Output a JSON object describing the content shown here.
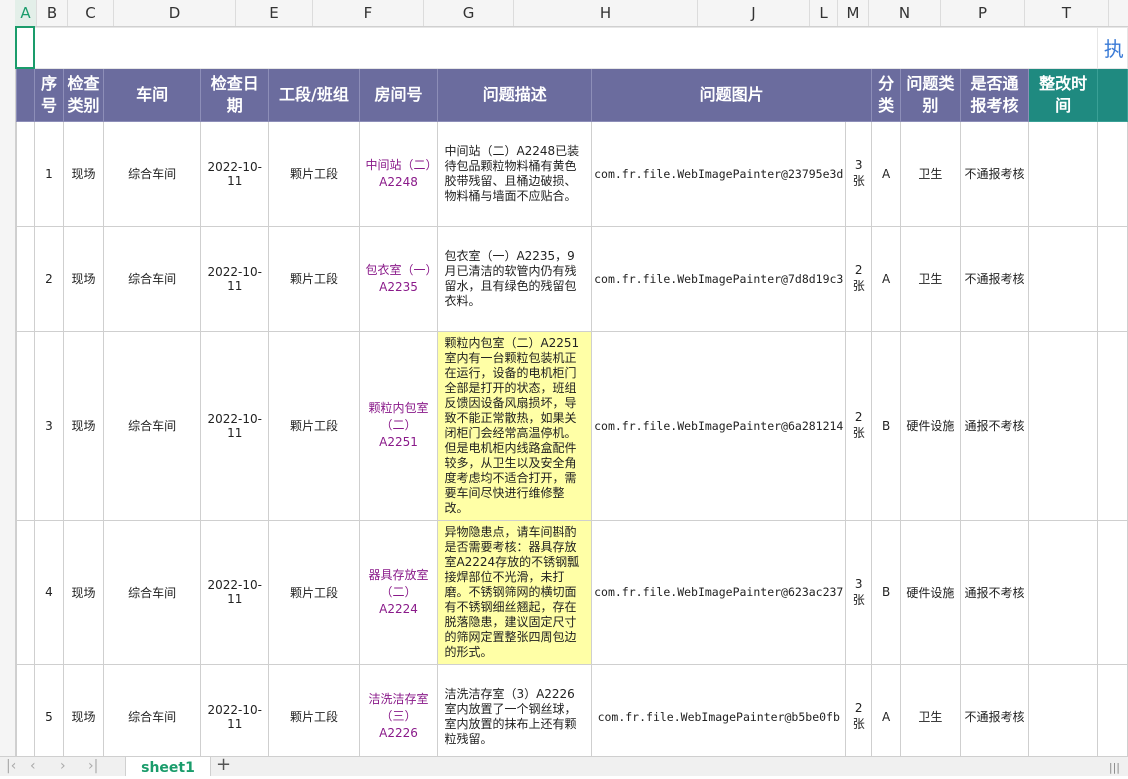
{
  "columns": [
    "A",
    "B",
    "C",
    "D",
    "E",
    "F",
    "G",
    "H",
    "J",
    "L",
    "M",
    "N",
    "P",
    "T"
  ],
  "title_partial": "执",
  "headers": {
    "seq": "序号",
    "check_type": "检查类别",
    "workshop": "车间",
    "check_date": "检查日期",
    "section": "工段/班组",
    "room": "房间号",
    "desc": "问题描述",
    "pic": "问题图片",
    "cls": "分类",
    "prob_type": "问题类别",
    "report": "是否通报考核",
    "fix_time": "整改时间"
  },
  "rows": [
    {
      "seq": "1",
      "type": "现场",
      "workshop": "综合车间",
      "date": "2022-10-11",
      "section": "颗片工段",
      "room": "中间站（二）A2248",
      "desc": "中间站（二）A2248已装待包品颗粒物料桶有黄色胶带残留、且桶边破损、物料桶与墙面不应贴合。",
      "pic": "com.fr.file.WebImagePainter@23795e3d",
      "count": "3张",
      "cls": "A",
      "prob": "卫生",
      "report": "不通报考核",
      "highlight": false
    },
    {
      "seq": "2",
      "type": "现场",
      "workshop": "综合车间",
      "date": "2022-10-11",
      "section": "颗片工段",
      "room": "包衣室（一）A2235",
      "desc": "包衣室（一）A2235，9月已清洁的软管内仍有残留水，且有绿色的残留包衣料。",
      "pic": "com.fr.file.WebImagePainter@7d8d19c3",
      "count": "2张",
      "cls": "A",
      "prob": "卫生",
      "report": "不通报考核",
      "highlight": false
    },
    {
      "seq": "3",
      "type": "现场",
      "workshop": "综合车间",
      "date": "2022-10-11",
      "section": "颗片工段",
      "room": "颗粒内包室（二）A2251",
      "desc": "颗粒内包室（二）A2251室内有一台颗粒包装机正在运行，设备的电机柜门全部是打开的状态，班组反馈因设备风扇损坏，导致不能正常散热，如果关闭柜门会经常高温停机。但是电机柜内线路盒配件较多，从卫生以及安全角度考虑均不适合打开，需要车间尽快进行维修整改。",
      "pic": "com.fr.file.WebImagePainter@6a281214",
      "count": "2张",
      "cls": "B",
      "prob": "硬件设施",
      "report": "通报不考核",
      "highlight": true
    },
    {
      "seq": "4",
      "type": "现场",
      "workshop": "综合车间",
      "date": "2022-10-11",
      "section": "颗片工段",
      "room": "器具存放室（二）A2224",
      "desc": "异物隐患点，请车间斟酌是否需要考核：器具存放室A2224存放的不锈钢瓢接焊部位不光滑，未打磨。不锈钢筛网的横切面有不锈钢细丝翘起，存在脱落隐患，建议固定尺寸的筛网定置整张四周包边的形式。",
      "pic": "com.fr.file.WebImagePainter@623ac237",
      "count": "3张",
      "cls": "B",
      "prob": "硬件设施",
      "report": "通报不考核",
      "highlight": true
    },
    {
      "seq": "5",
      "type": "现场",
      "workshop": "综合车间",
      "date": "2022-10-11",
      "section": "颗片工段",
      "room": "洁洗洁存室（三）A2226",
      "desc": "洁洗洁存室（3）A2226室内放置了一个钢丝球，室内放置的抹布上还有颗粒残留。",
      "pic": "com.fr.file.WebImagePainter@b5be0fb",
      "count": "2张",
      "cls": "A",
      "prob": "卫生",
      "report": "不通报考核",
      "highlight": false
    }
  ],
  "sheet_tab": "sheet1",
  "colors": {
    "header": "#6b6c9e",
    "teal": "#1f8a80",
    "highlight": "#ffffa6",
    "accent": "#1a9c6b"
  }
}
